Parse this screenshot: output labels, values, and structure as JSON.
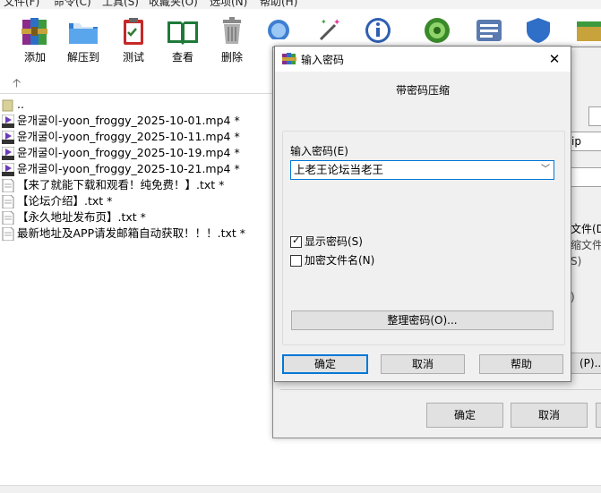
{
  "menu": [
    "文件(F)",
    "命令(C)",
    "工具(S)",
    "收藏夹(O)",
    "选项(N)",
    "帮助(H)"
  ],
  "toolbar": {
    "buttons": [
      {
        "label": "添加",
        "icon": "add-archive-icon"
      },
      {
        "label": "解压到",
        "icon": "extract-folder-icon"
      },
      {
        "label": "测试",
        "icon": "test-clipboard-icon"
      },
      {
        "label": "查看",
        "icon": "view-book-icon"
      },
      {
        "label": "删除",
        "icon": "delete-trash-icon"
      }
    ],
    "partial_icons": [
      "find-magnifier-icon",
      "wizard-wand-icon",
      "info-icon",
      "virus-scan-icon",
      "comment-icon",
      "protect-shield-icon",
      "sfx-icon"
    ]
  },
  "files": [
    {
      "name": "..",
      "type": "parent"
    },
    {
      "name": "윤개굴이-yoon_froggy_2025-10-01.mp4 *",
      "type": "mp4"
    },
    {
      "name": "윤개굴이-yoon_froggy_2025-10-11.mp4 *",
      "type": "mp4"
    },
    {
      "name": "윤개굴이-yoon_froggy_2025-10-19.mp4 *",
      "type": "mp4"
    },
    {
      "name": "윤개굴이-yoon_froggy_2025-10-21.mp4 *",
      "type": "mp4"
    },
    {
      "name": "【来了就能下载和观看！纯免费！】.txt *",
      "type": "txt"
    },
    {
      "name": "【论坛介绍】.txt *",
      "type": "txt"
    },
    {
      "name": "【永久地址发布页】.txt *",
      "type": "txt"
    },
    {
      "name": "最新地址及APP请发邮箱自动获取！！！.txt *",
      "type": "txt"
    }
  ],
  "mid_dialog": {
    "field1_text": "ip",
    "side_text1": "文件(D",
    "side_text2": "缩文件",
    "side_text3": "S)",
    "side_text4": ")",
    "side_button": "(P)...",
    "ok": "确定",
    "cancel": "取消"
  },
  "password_dialog": {
    "title": "输入密码",
    "heading": "带密码压缩",
    "password_label": "输入密码(E)",
    "password_value": "上老王论坛当老王",
    "show_password_label": "显示密码(S)",
    "show_password_checked": true,
    "encrypt_names_label": "加密文件名(N)",
    "encrypt_names_checked": false,
    "organize_button": "整理密码(O)...",
    "ok": "确定",
    "cancel": "取消",
    "help": "帮助",
    "close_glyph": "✕"
  },
  "colors": {
    "accent": "#0078d7",
    "dialog_bg": "#f0f0f0",
    "button_bg": "#e1e1e1"
  }
}
